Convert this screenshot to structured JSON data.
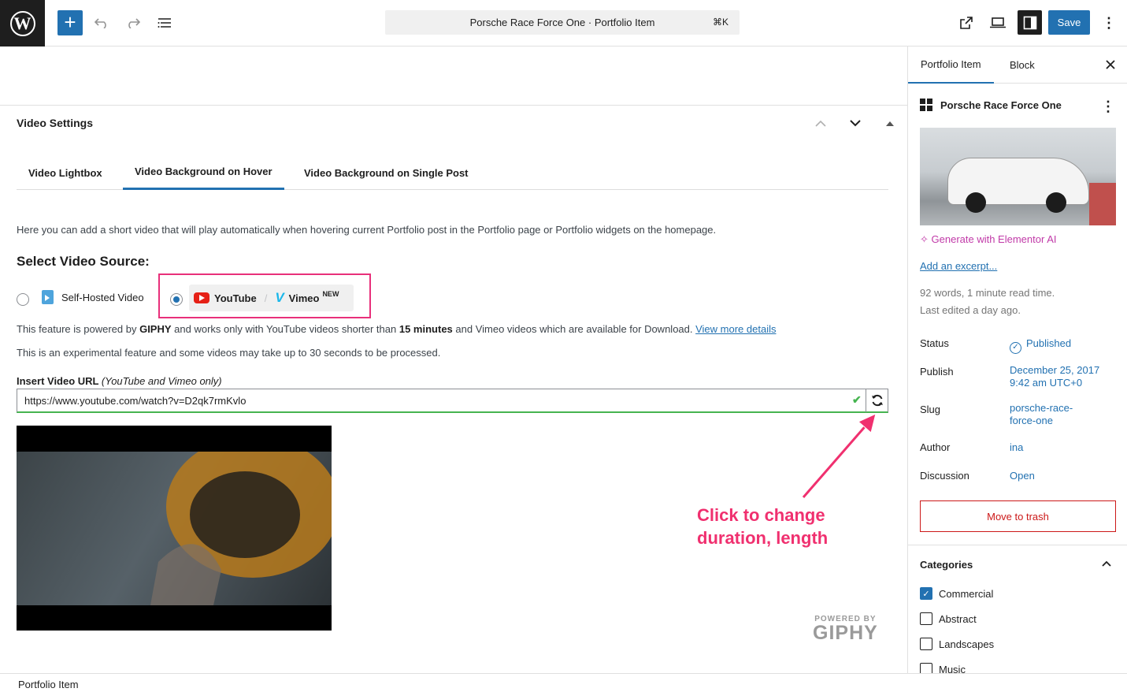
{
  "topbar": {
    "logo": "wordpress-logo",
    "add_label": "+",
    "command_title": "Porsche Race Force One · Portfolio Item",
    "command_shortcut": "⌘K",
    "save_label": "Save",
    "more_label": "⋮",
    "accent": "#2271b1"
  },
  "panel": {
    "title": "Video Settings",
    "tabs": [
      "Video Lightbox",
      "Video Background on Hover",
      "Video Background on Single Post"
    ],
    "active_tab": "Video Background on Hover",
    "description": "Here you can add a short video that will play automatically when hovering current Portfolio post in the Portfolio page or Portfolio widgets on the homepage.",
    "source_heading": "Select Video Source:",
    "source_self_hosted": "Self-Hosted Video",
    "source_youtube": "YouTube",
    "source_slash": "/",
    "source_vimeo": "Vimeo",
    "source_new_badge": "NEW",
    "selected_source": "YouTube / Vimeo",
    "feature_pre": "This feature is powered by ",
    "feature_giphy": "GIPHY",
    "feature_mid": " and works only with YouTube videos shorter than ",
    "feature_minutes": "15 minutes",
    "feature_post": " and Vimeo videos which are available for Download. ",
    "feature_link": "View more details",
    "experimental": "This is an experimental feature and some videos may take up to 30 seconds to be processed.",
    "url_label": "Insert Video URL",
    "url_hint": "(YouTube and Vimeo only)",
    "url_value": "https://www.youtube.com/watch?v=D2qk7rmKvlo",
    "annotation_line1": "Click to change",
    "annotation_line2": "duration, length",
    "giphy_powered": "POWERED BY",
    "giphy_brand": "GIPHY"
  },
  "footer": {
    "breadcrumb": "Portfolio Item"
  },
  "sidebar": {
    "tabs": [
      "Portfolio Item",
      "Block"
    ],
    "active_tab": "Portfolio Item",
    "post_title": "Porsche Race Force One",
    "ai_link": "Generate with Elementor AI",
    "excerpt_link": "Add an excerpt...",
    "meta_words": "92 words, 1 minute read time.",
    "meta_edited": "Last edited a day ago.",
    "rows": [
      {
        "label": "Status",
        "value": "Published"
      },
      {
        "label": "Publish",
        "value": "December 25, 2017 9:42 am UTC+0"
      },
      {
        "label": "Slug",
        "value": "porsche-race-force-one"
      },
      {
        "label": "Author",
        "value": "ina"
      },
      {
        "label": "Discussion",
        "value": "Open"
      }
    ],
    "trash_label": "Move to trash",
    "categories_title": "Categories",
    "categories": [
      {
        "label": "Commercial",
        "checked": true
      },
      {
        "label": "Abstract",
        "checked": false
      },
      {
        "label": "Landscapes",
        "checked": false
      },
      {
        "label": "Music",
        "checked": false
      }
    ]
  }
}
